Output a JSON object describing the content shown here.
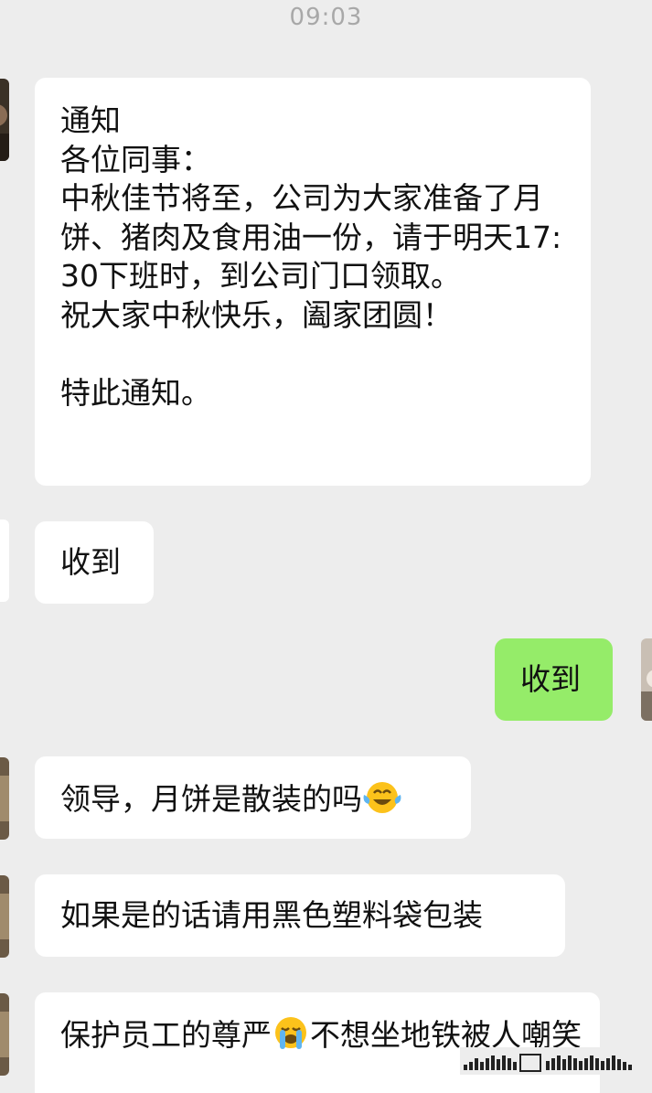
{
  "status": {
    "time": "09:03"
  },
  "messages": [
    {
      "side": "left",
      "text": "通知\n各位同事：\n中秋佳节将至，公司为大家准备了月饼、猪肉及食用油一份，请于明天17:30下班时，到公司门口领取。\n祝大家中秋快乐，阖家团圆！\n\n特此通知。"
    },
    {
      "side": "left",
      "text": "收到"
    },
    {
      "side": "right",
      "text": "收到"
    },
    {
      "side": "left",
      "text": "领导，月饼是散装的吗",
      "emoji": "tears-of-joy-emoji"
    },
    {
      "side": "left",
      "text": "如果是的话请用黑色塑料袋包装"
    },
    {
      "side": "left",
      "text_before": "保护员工的尊严",
      "emoji": "loudly-crying-emoji",
      "text_after": "不想坐地铁被人嘲笑"
    }
  ],
  "colors": {
    "background": "#ededed",
    "incoming_bubble": "#ffffff",
    "outgoing_bubble": "#95ec69"
  }
}
